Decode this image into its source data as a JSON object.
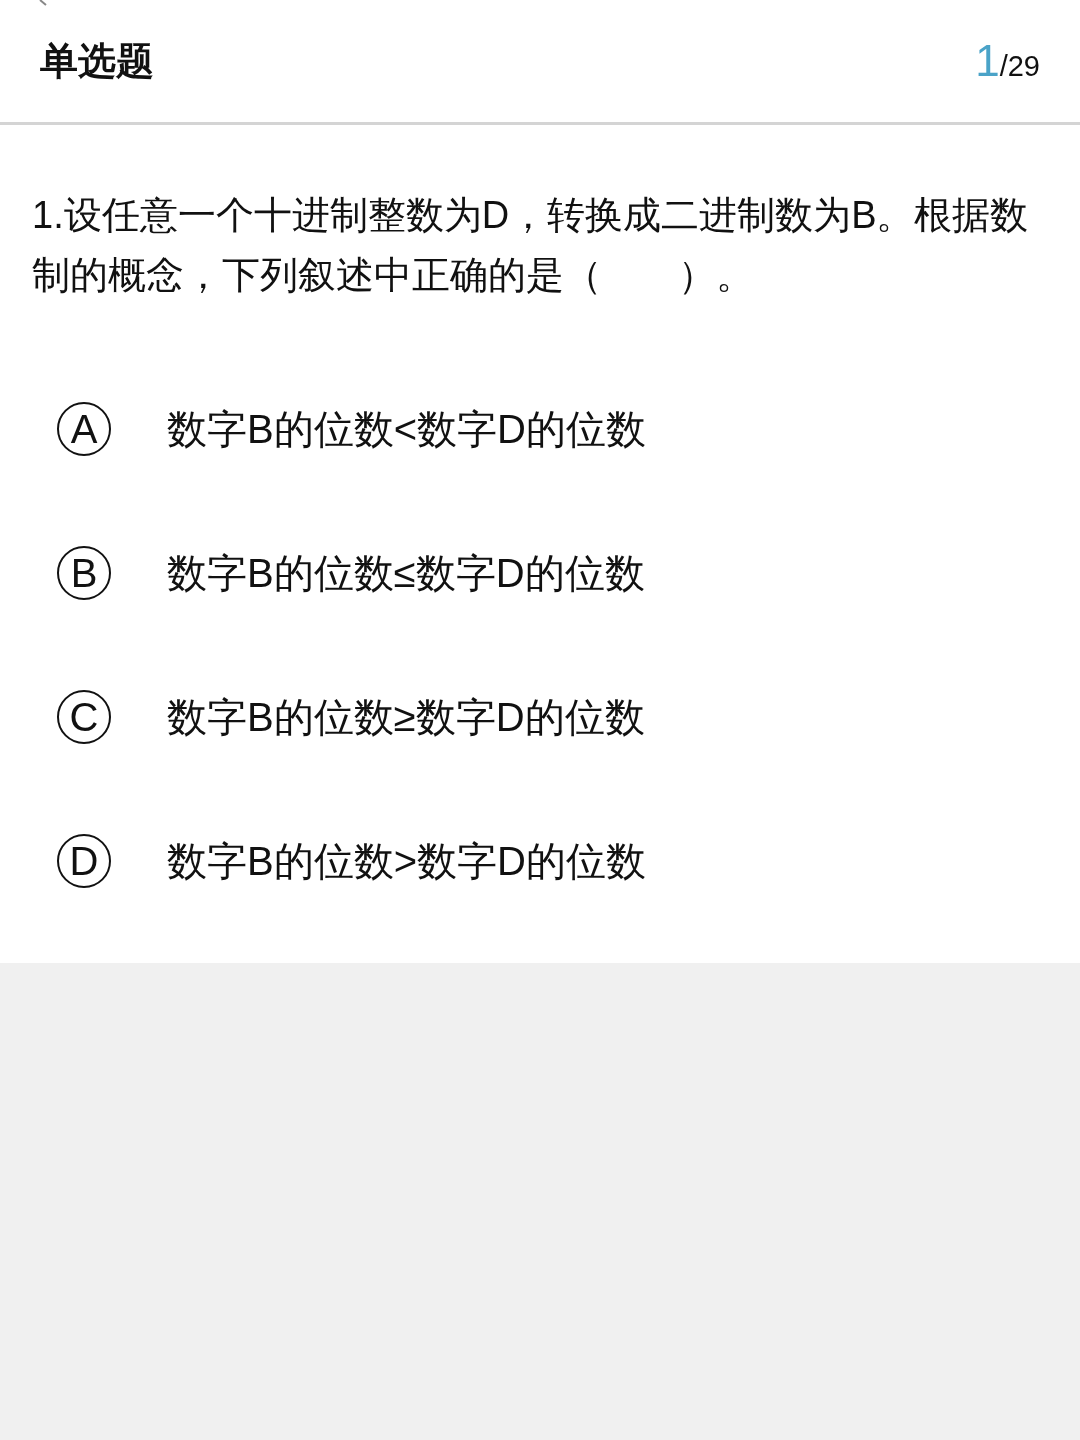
{
  "header": {
    "title": "单选题",
    "current": "1",
    "total": "/29"
  },
  "question": {
    "text": "1.设任意一个十进制整数为D，转换成二进制数为B。根据数制的概念，下列叙述中正确的是（　　）。"
  },
  "options": [
    {
      "letter": "A",
      "text": "数字B的位数<数字D的位数"
    },
    {
      "letter": "B",
      "text": "数字B的位数≤数字D的位数"
    },
    {
      "letter": "C",
      "text": "数字B的位数≥数字D的位数"
    },
    {
      "letter": "D",
      "text": "数字B的位数>数字D的位数"
    }
  ]
}
